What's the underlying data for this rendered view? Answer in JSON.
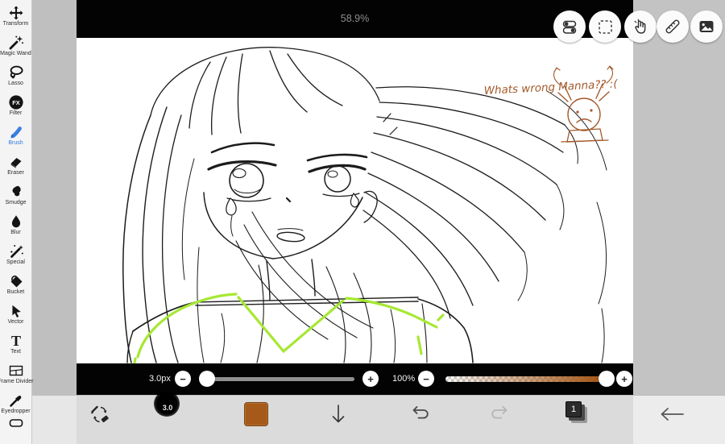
{
  "window": {
    "zoom_percent": "58.9%"
  },
  "sidebar": {
    "items": [
      {
        "label": "Transform",
        "selected": false
      },
      {
        "label": "Magic Wand",
        "selected": false
      },
      {
        "label": "Lasso",
        "selected": false
      },
      {
        "label": "Filter",
        "selected": false
      },
      {
        "label": "Brush",
        "selected": true
      },
      {
        "label": "Eraser",
        "selected": false
      },
      {
        "label": "Smudge",
        "selected": false
      },
      {
        "label": "Blur",
        "selected": false
      },
      {
        "label": "Special",
        "selected": false
      },
      {
        "label": "Bucket",
        "selected": false
      },
      {
        "label": "Vector",
        "selected": false
      },
      {
        "label": "Text",
        "selected": false
      },
      {
        "label": "Frame Divider",
        "selected": false
      },
      {
        "label": "Eyedropper",
        "selected": false
      }
    ]
  },
  "icons": {
    "filter_glyph": "FX",
    "text_glyph": "T"
  },
  "size_slider": {
    "label": "3.0px",
    "minus": "−",
    "plus": "+"
  },
  "opacity_slider": {
    "label": "100%",
    "minus": "−",
    "plus": "+"
  },
  "brush_preview": {
    "size": "3.0"
  },
  "layers": {
    "count": "1"
  },
  "colors": {
    "current_color": "#a55a19",
    "highlight_green": "#a6e832",
    "ink_brown": "#a3592a",
    "brush_blue": "#3a7fe0"
  },
  "canvas": {
    "annotation": "Whats wrong Manna?? :("
  }
}
